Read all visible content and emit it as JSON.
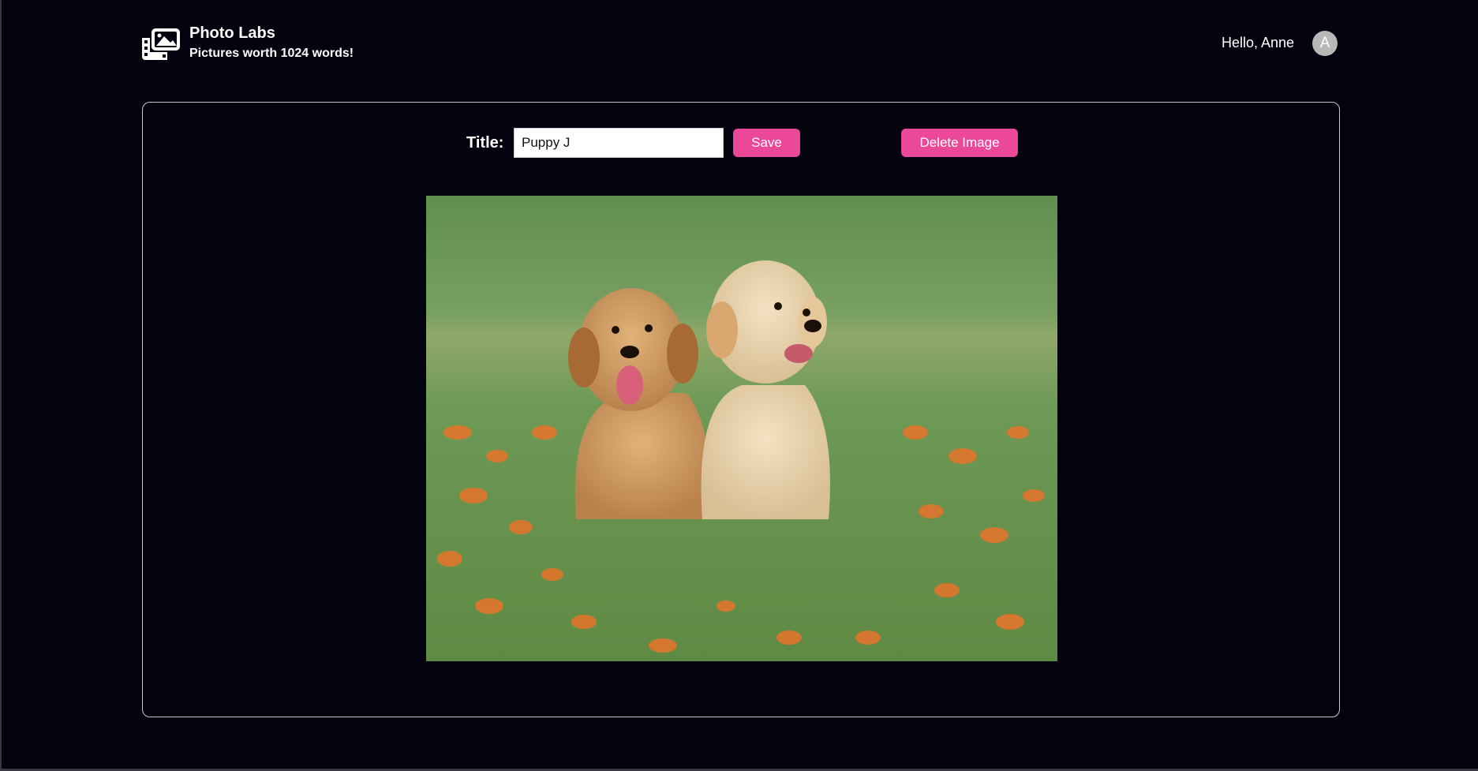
{
  "header": {
    "logo_icon": "photo-gallery-icon",
    "title": "Photo Labs",
    "subtitle": "Pictures worth 1024 words!",
    "greeting": "Hello, Anne",
    "avatar_initial": "A"
  },
  "editor": {
    "title_label": "Title:",
    "title_value": "Puppy J",
    "save_label": "Save",
    "delete_label": "Delete Image",
    "accent_color": "#ec4899",
    "image_subject": "two golden retriever puppies in grass with orange flowers"
  }
}
